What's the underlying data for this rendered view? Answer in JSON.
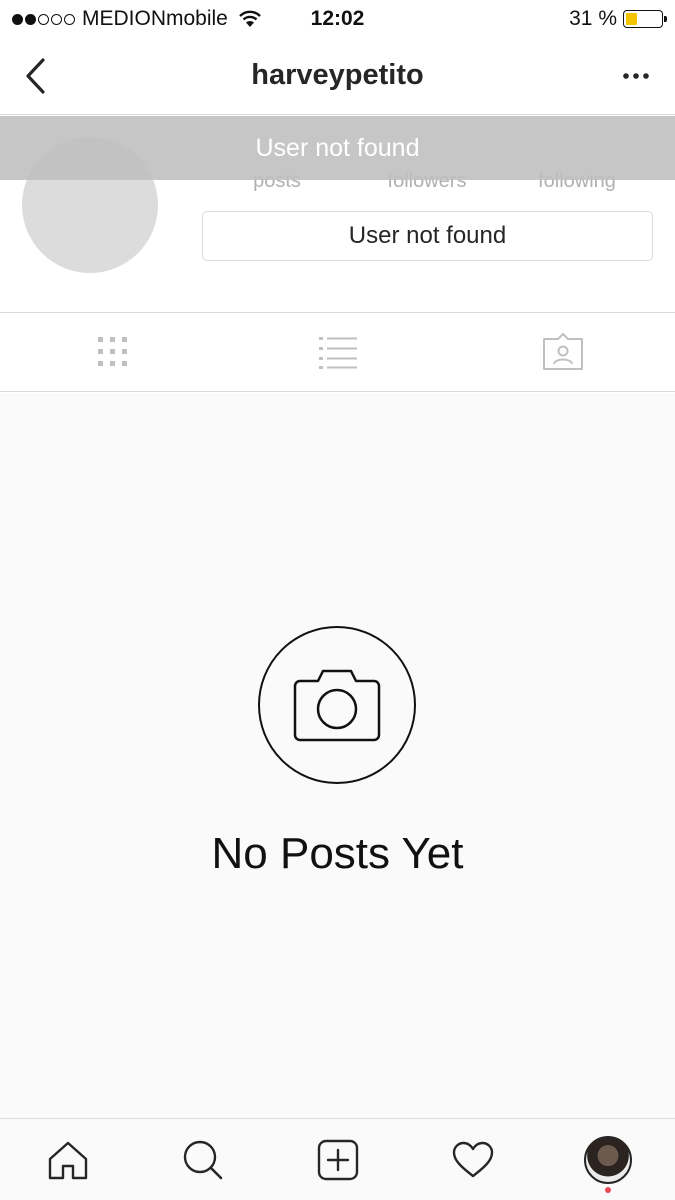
{
  "status_bar": {
    "carrier": "MEDION​mobile",
    "time": "12:02",
    "battery_percent": "31 %",
    "battery_level": 0.31,
    "battery_color": "#f5c400",
    "signal_bars_filled": 2,
    "signal_bars_total": 5
  },
  "nav": {
    "title": "harveypetito",
    "back_icon": "chevron-left-icon",
    "more_icon": "more-horizontal-icon"
  },
  "error_banner": {
    "text": "User not found"
  },
  "profile": {
    "stat_labels": [
      "posts",
      "followers",
      "following"
    ],
    "button_label": "User not found"
  },
  "view_tabs": [
    {
      "icon": "grid-icon"
    },
    {
      "icon": "list-icon"
    },
    {
      "icon": "tagged-photos-icon"
    }
  ],
  "empty_state": {
    "icon": "camera-icon",
    "text": "No Posts Yet"
  },
  "tab_bar": [
    {
      "icon": "home-icon"
    },
    {
      "icon": "search-icon"
    },
    {
      "icon": "add-post-icon"
    },
    {
      "icon": "heart-icon"
    },
    {
      "icon": "profile-avatar-icon",
      "has_notification": true,
      "notification_color": "#ed4956"
    }
  ]
}
